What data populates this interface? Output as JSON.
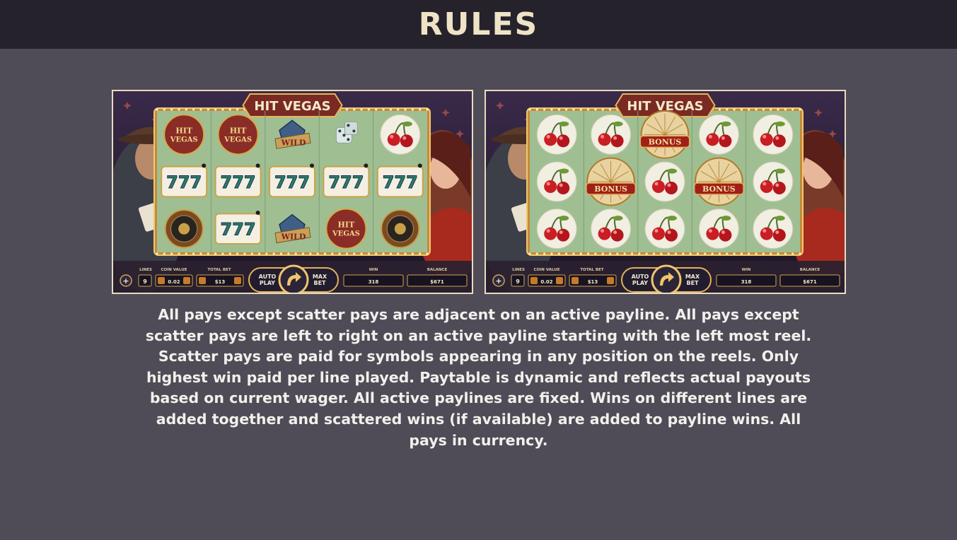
{
  "page": {
    "title": "RULES",
    "rules_text": "All pays except scatter pays are adjacent on an active payline. All pays except scatter pays are left to right on an active payline starting with the left most reel. Scatter pays are paid for symbols appearing in any position on the reels. Only highest win paid per line played. Paytable is dynamic and reflects actual payouts based on current wager. All active paylines are fixed. Wins on different lines are added together and scattered wins (if available) are added to payline wins. All pays in currency."
  },
  "colors": {
    "background": "#4f4c57",
    "header_bg": "#26222c",
    "title": "#efe3c6",
    "text": "#f3f0ec",
    "reel_green": "#9fbf93",
    "gold": "#d8a84a"
  },
  "screenshots": [
    {
      "logo": "HIT VEGAS",
      "reels": [
        [
          "hit-vegas",
          "hit-vegas",
          "wild",
          "dice",
          "cherry"
        ],
        [
          "777",
          "777",
          "777",
          "777",
          "777"
        ],
        [
          "roulette",
          "777",
          "wild",
          "hit-vegas",
          "roulette"
        ]
      ],
      "controls": {
        "lines_label": "LINES",
        "lines": "9",
        "coin_value_label": "COIN VALUE",
        "coin_value": "0.02",
        "total_bet_label": "TOTAL BET",
        "total_bet": "$13",
        "auto_play": "AUTO PLAY",
        "max_bet": "MAX BET",
        "win_label": "WIN",
        "win": "318",
        "balance_label": "BALANCE",
        "balance": "$671"
      }
    },
    {
      "logo": "HIT VEGAS",
      "reels": [
        [
          "cherry",
          "cherry",
          "bonus",
          "cherry",
          "cherry"
        ],
        [
          "cherry",
          "bonus",
          "cherry",
          "bonus",
          "cherry"
        ],
        [
          "cherry",
          "cherry",
          "cherry",
          "cherry",
          "cherry"
        ]
      ],
      "controls": {
        "lines_label": "LINES",
        "lines": "9",
        "coin_value_label": "COIN VALUE",
        "coin_value": "0.02",
        "total_bet_label": "TOTAL BET",
        "total_bet": "$13",
        "auto_play": "AUTO PLAY",
        "max_bet": "MAX BET",
        "win_label": "WIN",
        "win": "318",
        "balance_label": "BALANCE",
        "balance": "$671"
      }
    }
  ]
}
